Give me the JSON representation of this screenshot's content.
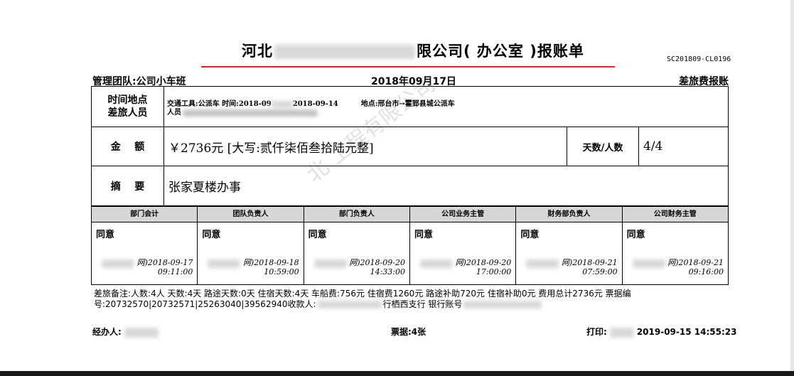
{
  "title": {
    "prefix": "河北",
    "suffix": "限公司(  办公室  )报账单",
    "code": "SC201809-CL0196"
  },
  "header": {
    "team": "管理团队:公司小车班",
    "date": "2018年09月17日",
    "type": "差旅费报账"
  },
  "rows": {
    "time_place": {
      "label_line1": "时间地点",
      "label_line2": "差旅人员",
      "transport": "交通工具:公派车  时间:2018-09",
      "date_end": "2018-09-14",
      "location": "地点:邢台市→霍郅县城公派车",
      "people": "人员"
    },
    "amount": {
      "label": "金    额",
      "value": "￥2736元 [大写:贰仟柒佰叁拾陆元整]",
      "days_label": "天数/人数",
      "days_value": "4/4"
    },
    "summary": {
      "label": "摘    要",
      "value": "张家夏楼办事"
    }
  },
  "approvals": [
    {
      "title": "部门会计",
      "status": "同意",
      "date": "网)2018-09-17",
      "time": "09:11:00"
    },
    {
      "title": "团队负责人",
      "status": "同意",
      "date": "网)2018-09-18",
      "time": "10:59:00"
    },
    {
      "title": "部门负责人",
      "status": "同意",
      "date": "网)2018-09-20",
      "time": "14:33:00"
    },
    {
      "title": "公司业务主管",
      "status": "同意",
      "date": "网)2018-09-20",
      "time": "17:00:00"
    },
    {
      "title": "财务部负责人",
      "status": "同意",
      "date": "网)2018-09-21",
      "time": "07:59:00"
    },
    {
      "title": "公司财务主管",
      "status": "同意",
      "date": "网)2018-09-21",
      "time": "09:16:00"
    }
  ],
  "remark": {
    "line1": "差旅备注:人数:4人  天数:4天  路途天数:0天  住宿天数:4天  车船费:756元  住宿费1260元  路途补助720元  住宿补助0元  费用总计2736元   票据编",
    "line2": "号:20732570|20732571|25263040|39562940收款人:",
    "line2_tail": "行栖西支行 银行账号"
  },
  "footer": {
    "handler_label": "经办人:",
    "receipts": "票据:4张",
    "print_label": "打印:",
    "print_time": "2019-09-15  14:55:23"
  },
  "watermark": "北         工程有限公司"
}
